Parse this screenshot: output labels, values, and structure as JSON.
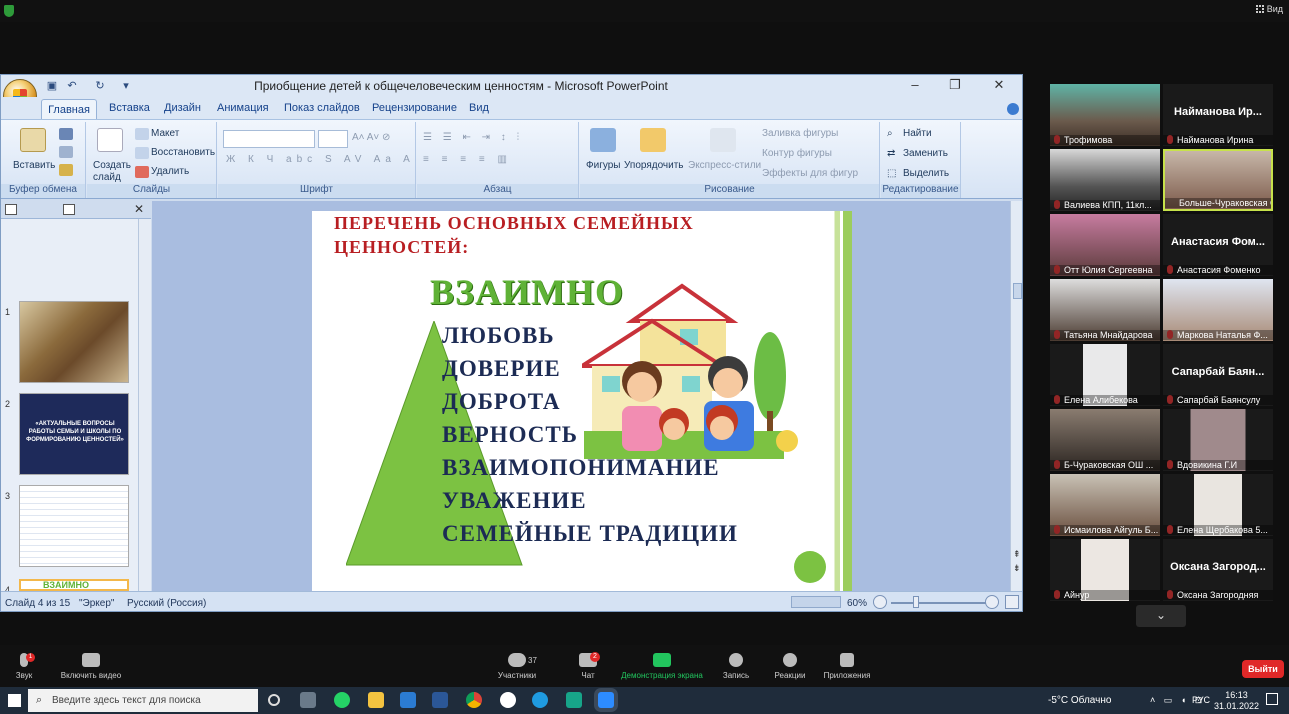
{
  "zoom": {
    "view_label": "Вид",
    "more_button": "⌄",
    "toolbar": [
      {
        "id": "audio",
        "label": "Звук",
        "badge": "1"
      },
      {
        "id": "video",
        "label": "Включить видео"
      },
      {
        "id": "participants",
        "label": "Участники",
        "count": "37"
      },
      {
        "id": "chat",
        "label": "Чат",
        "badge": "2"
      },
      {
        "id": "share",
        "label": "Демонстрация экрана"
      },
      {
        "id": "record",
        "label": "Запись"
      },
      {
        "id": "reactions",
        "label": "Реакции"
      },
      {
        "id": "apps",
        "label": "Приложения"
      }
    ],
    "leave_label": "Выйти",
    "participants": [
      {
        "name": "Трофимова",
        "video": true
      },
      {
        "name": "Найманова Ирина",
        "big": "Найманова Ир...",
        "video": false
      },
      {
        "name": "Валиева КПП, 11кл...",
        "video": true
      },
      {
        "name": "Больше-Чураковская С...",
        "video": true,
        "active": true
      },
      {
        "name": "Отт Юлия Сергеевна",
        "video": true
      },
      {
        "name": "Анастасия Фоменко",
        "big": "Анастасия Фом...",
        "video": false
      },
      {
        "name": "Татьяна Мнайдарова",
        "video": true
      },
      {
        "name": "Маркова Наталья Ф...",
        "video": true
      },
      {
        "name": "Елена Алибекова",
        "video": true
      },
      {
        "name": "Сапарбай Баянсулу",
        "big": "Сапарбай Баян...",
        "video": false
      },
      {
        "name": "Б-Чураковская ОШ ...",
        "video": true
      },
      {
        "name": "Вдовикина Г.И",
        "video": true
      },
      {
        "name": "Исмаилова Айгуль Б...",
        "video": true
      },
      {
        "name": "Елена Щербакова 5...",
        "video": true
      },
      {
        "name": "Айнур",
        "video": true
      },
      {
        "name": "Оксана Загородняя",
        "big": "Оксана Загород...",
        "video": false
      }
    ]
  },
  "ppt": {
    "title": "Приобщение детей к общечеловеческим ценностям - Microsoft PowerPoint",
    "tabs": [
      "Главная",
      "Вставка",
      "Дизайн",
      "Анимация",
      "Показ слайдов",
      "Рецензирование",
      "Вид"
    ],
    "ribbon": {
      "clipboard": {
        "label": "Буфер обмена",
        "paste": "Вставить"
      },
      "slides": {
        "label": "Слайды",
        "new_slide": "Создать слайд",
        "layout": "Макет",
        "reset": "Восстановить",
        "delete": "Удалить"
      },
      "font": {
        "label": "Шрифт"
      },
      "paragraph": {
        "label": "Абзац"
      },
      "drawing": {
        "label": "Рисование",
        "shapes": "Фигуры",
        "arrange": "Упорядочить",
        "styles": "Экспресс-стили",
        "fill": "Заливка фигуры",
        "outline": "Контур фигуры",
        "effects": "Эффекты для фигур"
      },
      "editing": {
        "label": "Редактирование",
        "find": "Найти",
        "replace": "Заменить",
        "select": "Выделить"
      }
    },
    "thumbnails": [
      {
        "num": "1"
      },
      {
        "num": "2",
        "text": "«АКТУАЛЬНЫЕ ВОПРОСЫ РАБОТЫ СЕМЬИ И ШКОЛЫ ПО ФОРМИРОВАНИЮ ЦЕННОСТЕЙ»"
      },
      {
        "num": "3"
      },
      {
        "num": "4",
        "text": "ВЗАИМНО"
      }
    ],
    "slide": {
      "title": "Перечень основных семейных ценностей:",
      "heading": "ВЗАИМНО",
      "items": [
        "ЛЮБОВЬ",
        "ДОВЕРИЕ",
        "ДОБРОТА",
        "ВЕРНОСТЬ",
        "ВЗАИМОПОНИМАНИЕ",
        "УВАЖЕНИЕ",
        "СЕМЕЙНЫЕ ТРАДИЦИИ"
      ]
    },
    "status": {
      "slide_info": "Слайд 4 из 15",
      "theme": "\"Эркер\"",
      "language": "Русский (Россия)",
      "zoom": "60%"
    }
  },
  "taskbar": {
    "search_placeholder": "Введите здесь текст для поиска",
    "weather": "-5°C  Облачно",
    "lang": "РУС",
    "time": "16:13",
    "date": "31.01.2022"
  }
}
